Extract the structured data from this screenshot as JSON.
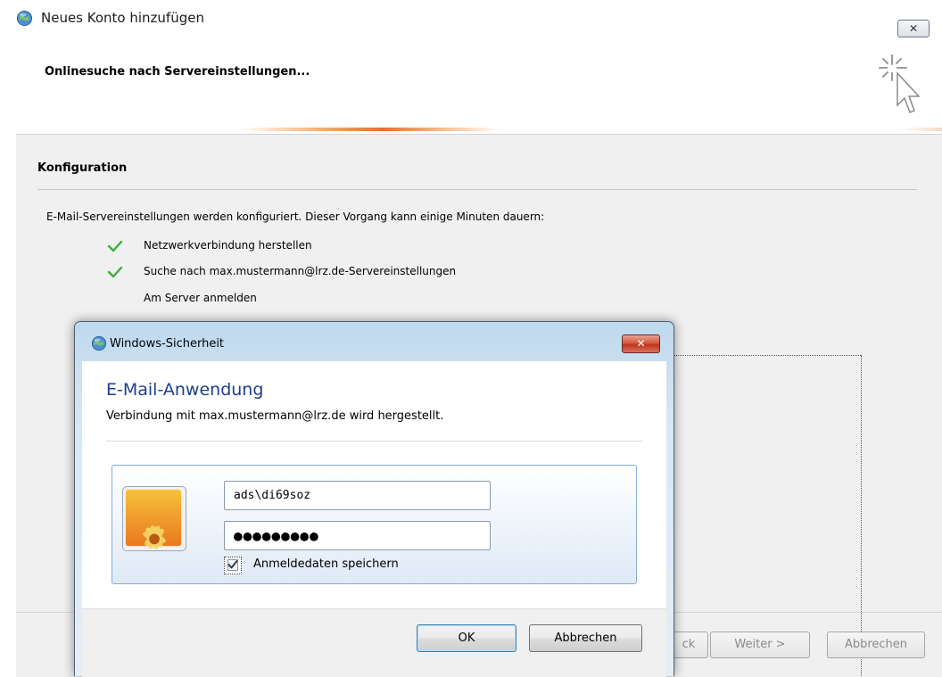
{
  "window": {
    "title": "Neues Konto hinzufügen",
    "close_symbol": "✕"
  },
  "header": {
    "title": "Onlinesuche nach Servereinstellungen..."
  },
  "section": {
    "title": "Konfiguration",
    "info": "E-Mail-Servereinstellungen werden konfiguriert. Dieser Vorgang kann einige Minuten dauern:"
  },
  "steps": [
    {
      "label": "Netzwerkverbindung herstellen",
      "done": true
    },
    {
      "label": "Suche nach max.mustermann@lrz.de-Servereinstellungen",
      "done": true
    },
    {
      "label": "Am Server anmelden",
      "done": false
    }
  ],
  "footer": {
    "back_label": "< Zurück",
    "back_visible": "ck",
    "next_label": "Weiter >",
    "cancel_label": "Abbrechen"
  },
  "security_dialog": {
    "title": "Windows-Sicherheit",
    "close_symbol": "✕",
    "heading": "E-Mail-Anwendung",
    "subtitle": "Verbindung mit max.mustermann@lrz.de wird hergestellt.",
    "username_value": "ads\\di69soz",
    "password_masked": "●●●●●●●●●",
    "remember_label": "Anmeldedaten speichern",
    "remember_checked": true,
    "ok_label": "OK",
    "cancel_label": "Abbrechen"
  },
  "colors": {
    "heading_blue": "#1e3d8f",
    "check_green": "#3fae3a",
    "progress_orange": "#ee6f23"
  }
}
